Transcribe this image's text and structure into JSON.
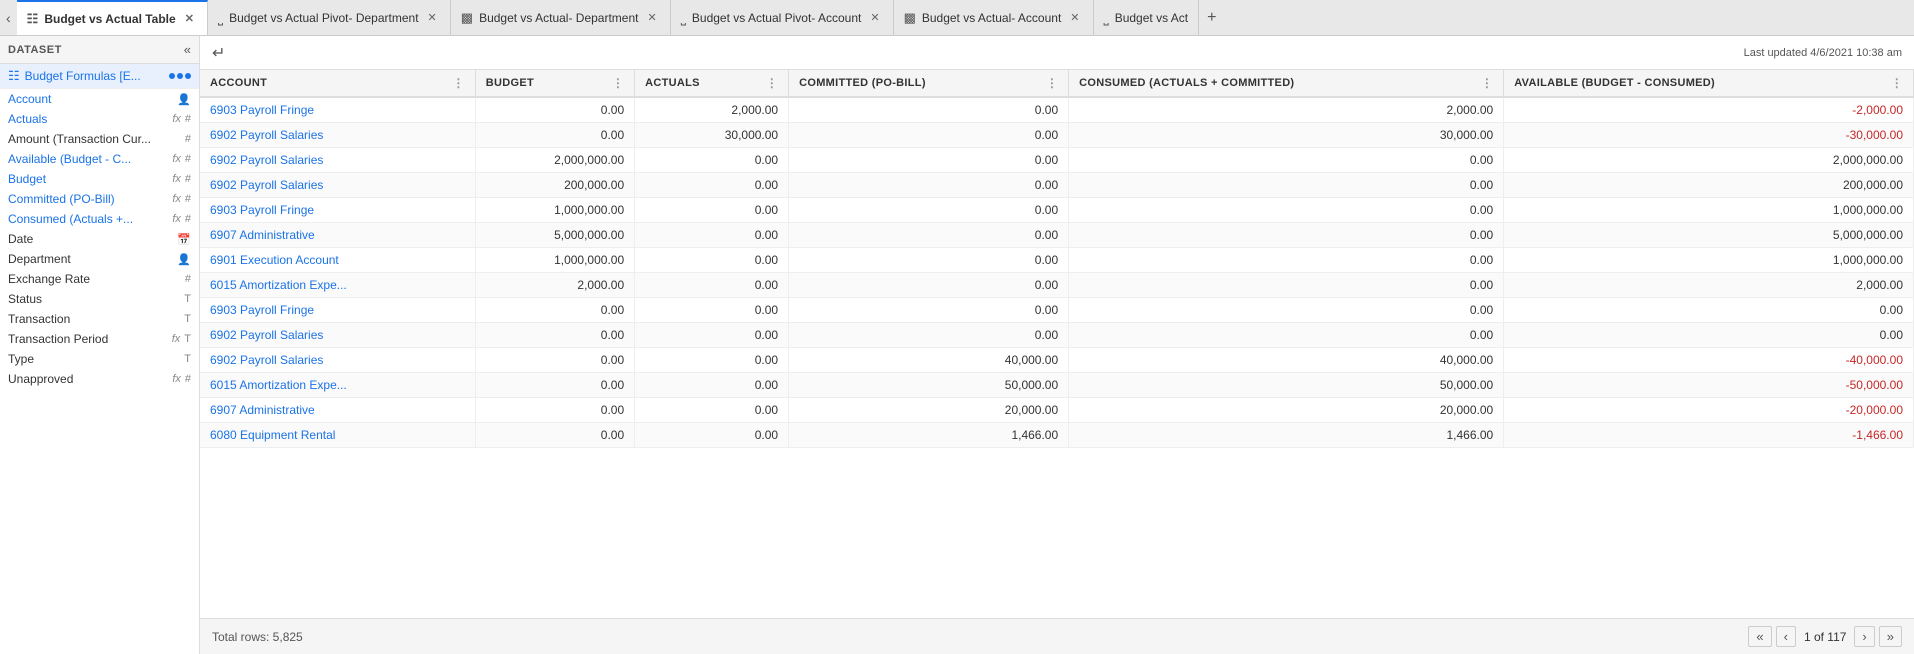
{
  "tabs": [
    {
      "id": "tab1",
      "label": "Budget vs Actual Table",
      "icon": "table",
      "active": true
    },
    {
      "id": "tab2",
      "label": "Budget vs Actual Pivot- Department",
      "icon": "pivot",
      "active": false
    },
    {
      "id": "tab3",
      "label": "Budget vs Actual- Department",
      "icon": "chart",
      "active": false
    },
    {
      "id": "tab4",
      "label": "Budget vs Actual Pivot- Account",
      "icon": "pivot",
      "active": false
    },
    {
      "id": "tab5",
      "label": "Budget vs Actual- Account",
      "icon": "chart",
      "active": false
    },
    {
      "id": "tab6",
      "label": "Budget vs Act",
      "icon": "pivot",
      "active": false
    }
  ],
  "sidebar": {
    "header_label": "DATASET",
    "dataset_item": {
      "label": "Budget Formulas [E...",
      "icon": "grid"
    },
    "fields": [
      {
        "label": "Account",
        "type": "person",
        "has_fx": false,
        "blue": true
      },
      {
        "label": "Actuals",
        "type": "hash",
        "has_fx": true,
        "blue": true
      },
      {
        "label": "Amount (Transaction Cur...",
        "type": "hash",
        "has_fx": false,
        "blue": false
      },
      {
        "label": "Available (Budget - C...",
        "type": "hash",
        "has_fx": true,
        "blue": true
      },
      {
        "label": "Budget",
        "type": "hash",
        "has_fx": true,
        "blue": true
      },
      {
        "label": "Committed (PO-Bill)",
        "type": "hash",
        "has_fx": true,
        "blue": true
      },
      {
        "label": "Consumed (Actuals +...",
        "type": "hash",
        "has_fx": true,
        "blue": true
      },
      {
        "label": "Date",
        "type": "calendar",
        "has_fx": false,
        "blue": false
      },
      {
        "label": "Department",
        "type": "person",
        "has_fx": false,
        "blue": false
      },
      {
        "label": "Exchange Rate",
        "type": "hash",
        "has_fx": false,
        "blue": false
      },
      {
        "label": "Status",
        "type": "text",
        "has_fx": false,
        "blue": false
      },
      {
        "label": "Transaction",
        "type": "text",
        "has_fx": false,
        "blue": false
      },
      {
        "label": "Transaction Period",
        "type": "text",
        "has_fx": true,
        "blue": false
      },
      {
        "label": "Type",
        "type": "text",
        "has_fx": false,
        "blue": false
      },
      {
        "label": "Unapproved",
        "type": "hash",
        "has_fx": true,
        "blue": false
      }
    ]
  },
  "toolbar": {
    "last_updated": "Last updated 4/6/2021 10:38 am"
  },
  "columns": [
    {
      "id": "account",
      "label": "ACCOUNT"
    },
    {
      "id": "budget",
      "label": "BUDGET"
    },
    {
      "id": "actuals",
      "label": "ACTUALS"
    },
    {
      "id": "committed",
      "label": "COMMITTED (PO-BILL)"
    },
    {
      "id": "consumed",
      "label": "CONSUMED (ACTUALS + COMMITTED)"
    },
    {
      "id": "available",
      "label": "AVAILABLE (BUDGET - CONSUMED)"
    }
  ],
  "rows": [
    {
      "account": "6903 Payroll Fringe",
      "budget": "0.00",
      "actuals": "2,000.00",
      "committed": "0.00",
      "consumed": "2,000.00",
      "available": "-2,000.00",
      "available_neg": true
    },
    {
      "account": "6902 Payroll Salaries",
      "budget": "0.00",
      "actuals": "30,000.00",
      "committed": "0.00",
      "consumed": "30,000.00",
      "available": "-30,000.00",
      "available_neg": true
    },
    {
      "account": "6902 Payroll Salaries",
      "budget": "2,000,000.00",
      "actuals": "0.00",
      "committed": "0.00",
      "consumed": "0.00",
      "available": "2,000,000.00",
      "available_neg": false
    },
    {
      "account": "6902 Payroll Salaries",
      "budget": "200,000.00",
      "actuals": "0.00",
      "committed": "0.00",
      "consumed": "0.00",
      "available": "200,000.00",
      "available_neg": false
    },
    {
      "account": "6903 Payroll Fringe",
      "budget": "1,000,000.00",
      "actuals": "0.00",
      "committed": "0.00",
      "consumed": "0.00",
      "available": "1,000,000.00",
      "available_neg": false
    },
    {
      "account": "6907 Administrative",
      "budget": "5,000,000.00",
      "actuals": "0.00",
      "committed": "0.00",
      "consumed": "0.00",
      "available": "5,000,000.00",
      "available_neg": false
    },
    {
      "account": "6901 Execution Account",
      "budget": "1,000,000.00",
      "actuals": "0.00",
      "committed": "0.00",
      "consumed": "0.00",
      "available": "1,000,000.00",
      "available_neg": false
    },
    {
      "account": "6015 Amortization Expe...",
      "budget": "2,000.00",
      "actuals": "0.00",
      "committed": "0.00",
      "consumed": "0.00",
      "available": "2,000.00",
      "available_neg": false
    },
    {
      "account": "6903 Payroll Fringe",
      "budget": "0.00",
      "actuals": "0.00",
      "committed": "0.00",
      "consumed": "0.00",
      "available": "0.00",
      "available_neg": false
    },
    {
      "account": "6902 Payroll Salaries",
      "budget": "0.00",
      "actuals": "0.00",
      "committed": "0.00",
      "consumed": "0.00",
      "available": "0.00",
      "available_neg": false
    },
    {
      "account": "6902 Payroll Salaries",
      "budget": "0.00",
      "actuals": "0.00",
      "committed": "40,000.00",
      "consumed": "40,000.00",
      "available": "-40,000.00",
      "available_neg": true
    },
    {
      "account": "6015 Amortization Expe...",
      "budget": "0.00",
      "actuals": "0.00",
      "committed": "50,000.00",
      "consumed": "50,000.00",
      "available": "-50,000.00",
      "available_neg": true
    },
    {
      "account": "6907 Administrative",
      "budget": "0.00",
      "actuals": "0.00",
      "committed": "20,000.00",
      "consumed": "20,000.00",
      "available": "-20,000.00",
      "available_neg": true
    },
    {
      "account": "6080 Equipment Rental",
      "budget": "0.00",
      "actuals": "0.00",
      "committed": "1,466.00",
      "consumed": "1,466.00",
      "available": "-1,466.00",
      "available_neg": true
    }
  ],
  "footer": {
    "total_rows_label": "Total rows: 5,825",
    "pagination": {
      "current": "1 of 117"
    }
  }
}
